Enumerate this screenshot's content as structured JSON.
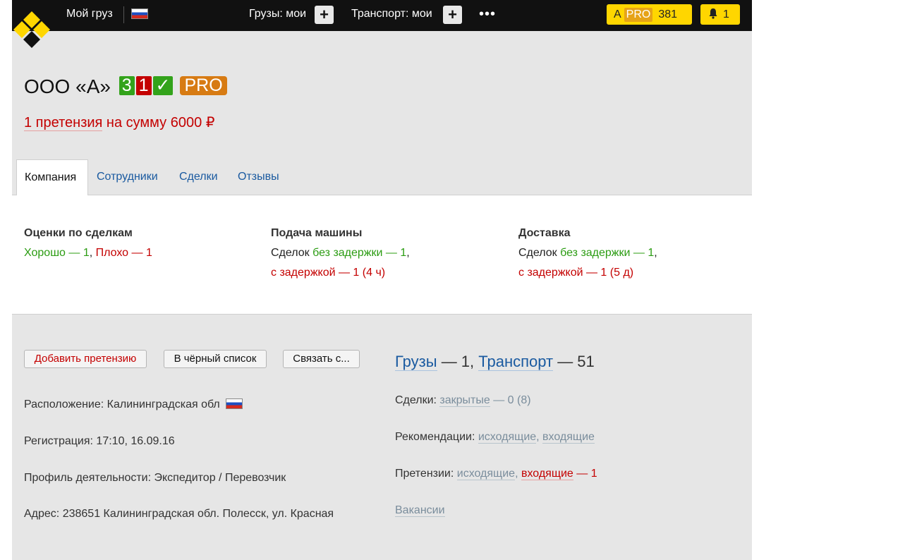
{
  "topbar": {
    "my_cargo": "Мой груз",
    "cargos_label": "Грузы: мои",
    "transport_label": "Транспорт: мои",
    "plus": "+",
    "more": "•••",
    "pro_prefix": "A",
    "pro_label": "PRO",
    "pro_count": "381",
    "notifications_count": "1"
  },
  "company": {
    "name": "ООО «А»",
    "rating_good": "3",
    "rating_bad": "1",
    "rating_check": "✓",
    "pro": "PRO"
  },
  "claim": {
    "link": "1 претензия",
    "rest": " на сумму 6000 ₽"
  },
  "tabs": [
    {
      "label": "Компания"
    },
    {
      "label": "Сотрудники"
    },
    {
      "label": "Сделки"
    },
    {
      "label": "Отзывы"
    }
  ],
  "stats": {
    "ratings": {
      "title": "Оценки по сделкам",
      "good": "Хорошо — 1",
      "comma": ", ",
      "bad": "Плохо — 1"
    },
    "pickup": {
      "title": "Подача машины",
      "prefix": "Сделок ",
      "ontime": "без задержки — 1",
      "comma": ",",
      "delayed": "с задержкой — 1 (4 ч)"
    },
    "delivery": {
      "title": "Доставка",
      "prefix": "Сделок ",
      "ontime": "без задержки — 1",
      "comma": ",",
      "delayed": "с задержкой — 1 (5 д)"
    }
  },
  "buttons": {
    "add_claim": "Добавить претензию",
    "blacklist": "В чёрный список",
    "contact": "Связать с..."
  },
  "info": {
    "location": "Расположение: Калининградская обл",
    "registration": "Регистрация: 17:10, 16.09.16",
    "profile": "Профиль деятельности: Экспедитор / Перевозчик",
    "address": "Адрес: 238651 Калининградская обл. Полесск, ул. Красная"
  },
  "links": {
    "cargos": "Грузы",
    "cargos_count": " — 1, ",
    "transport": "Транспорт",
    "transport_count": " — 51",
    "deals_label": "Сделки: ",
    "deals_closed": "закрытые",
    "deals_count": " — 0 (8)",
    "recs_label": "Рекомендации: ",
    "recs_out": "исходящие",
    "recs_sep": ", ",
    "recs_in": "входящие",
    "claims_label": "Претензии: ",
    "claims_out": "исходящие",
    "claims_sep": ", ",
    "claims_in": "входящие",
    "claims_count": " — 1",
    "vacancies": "Вакансии"
  }
}
